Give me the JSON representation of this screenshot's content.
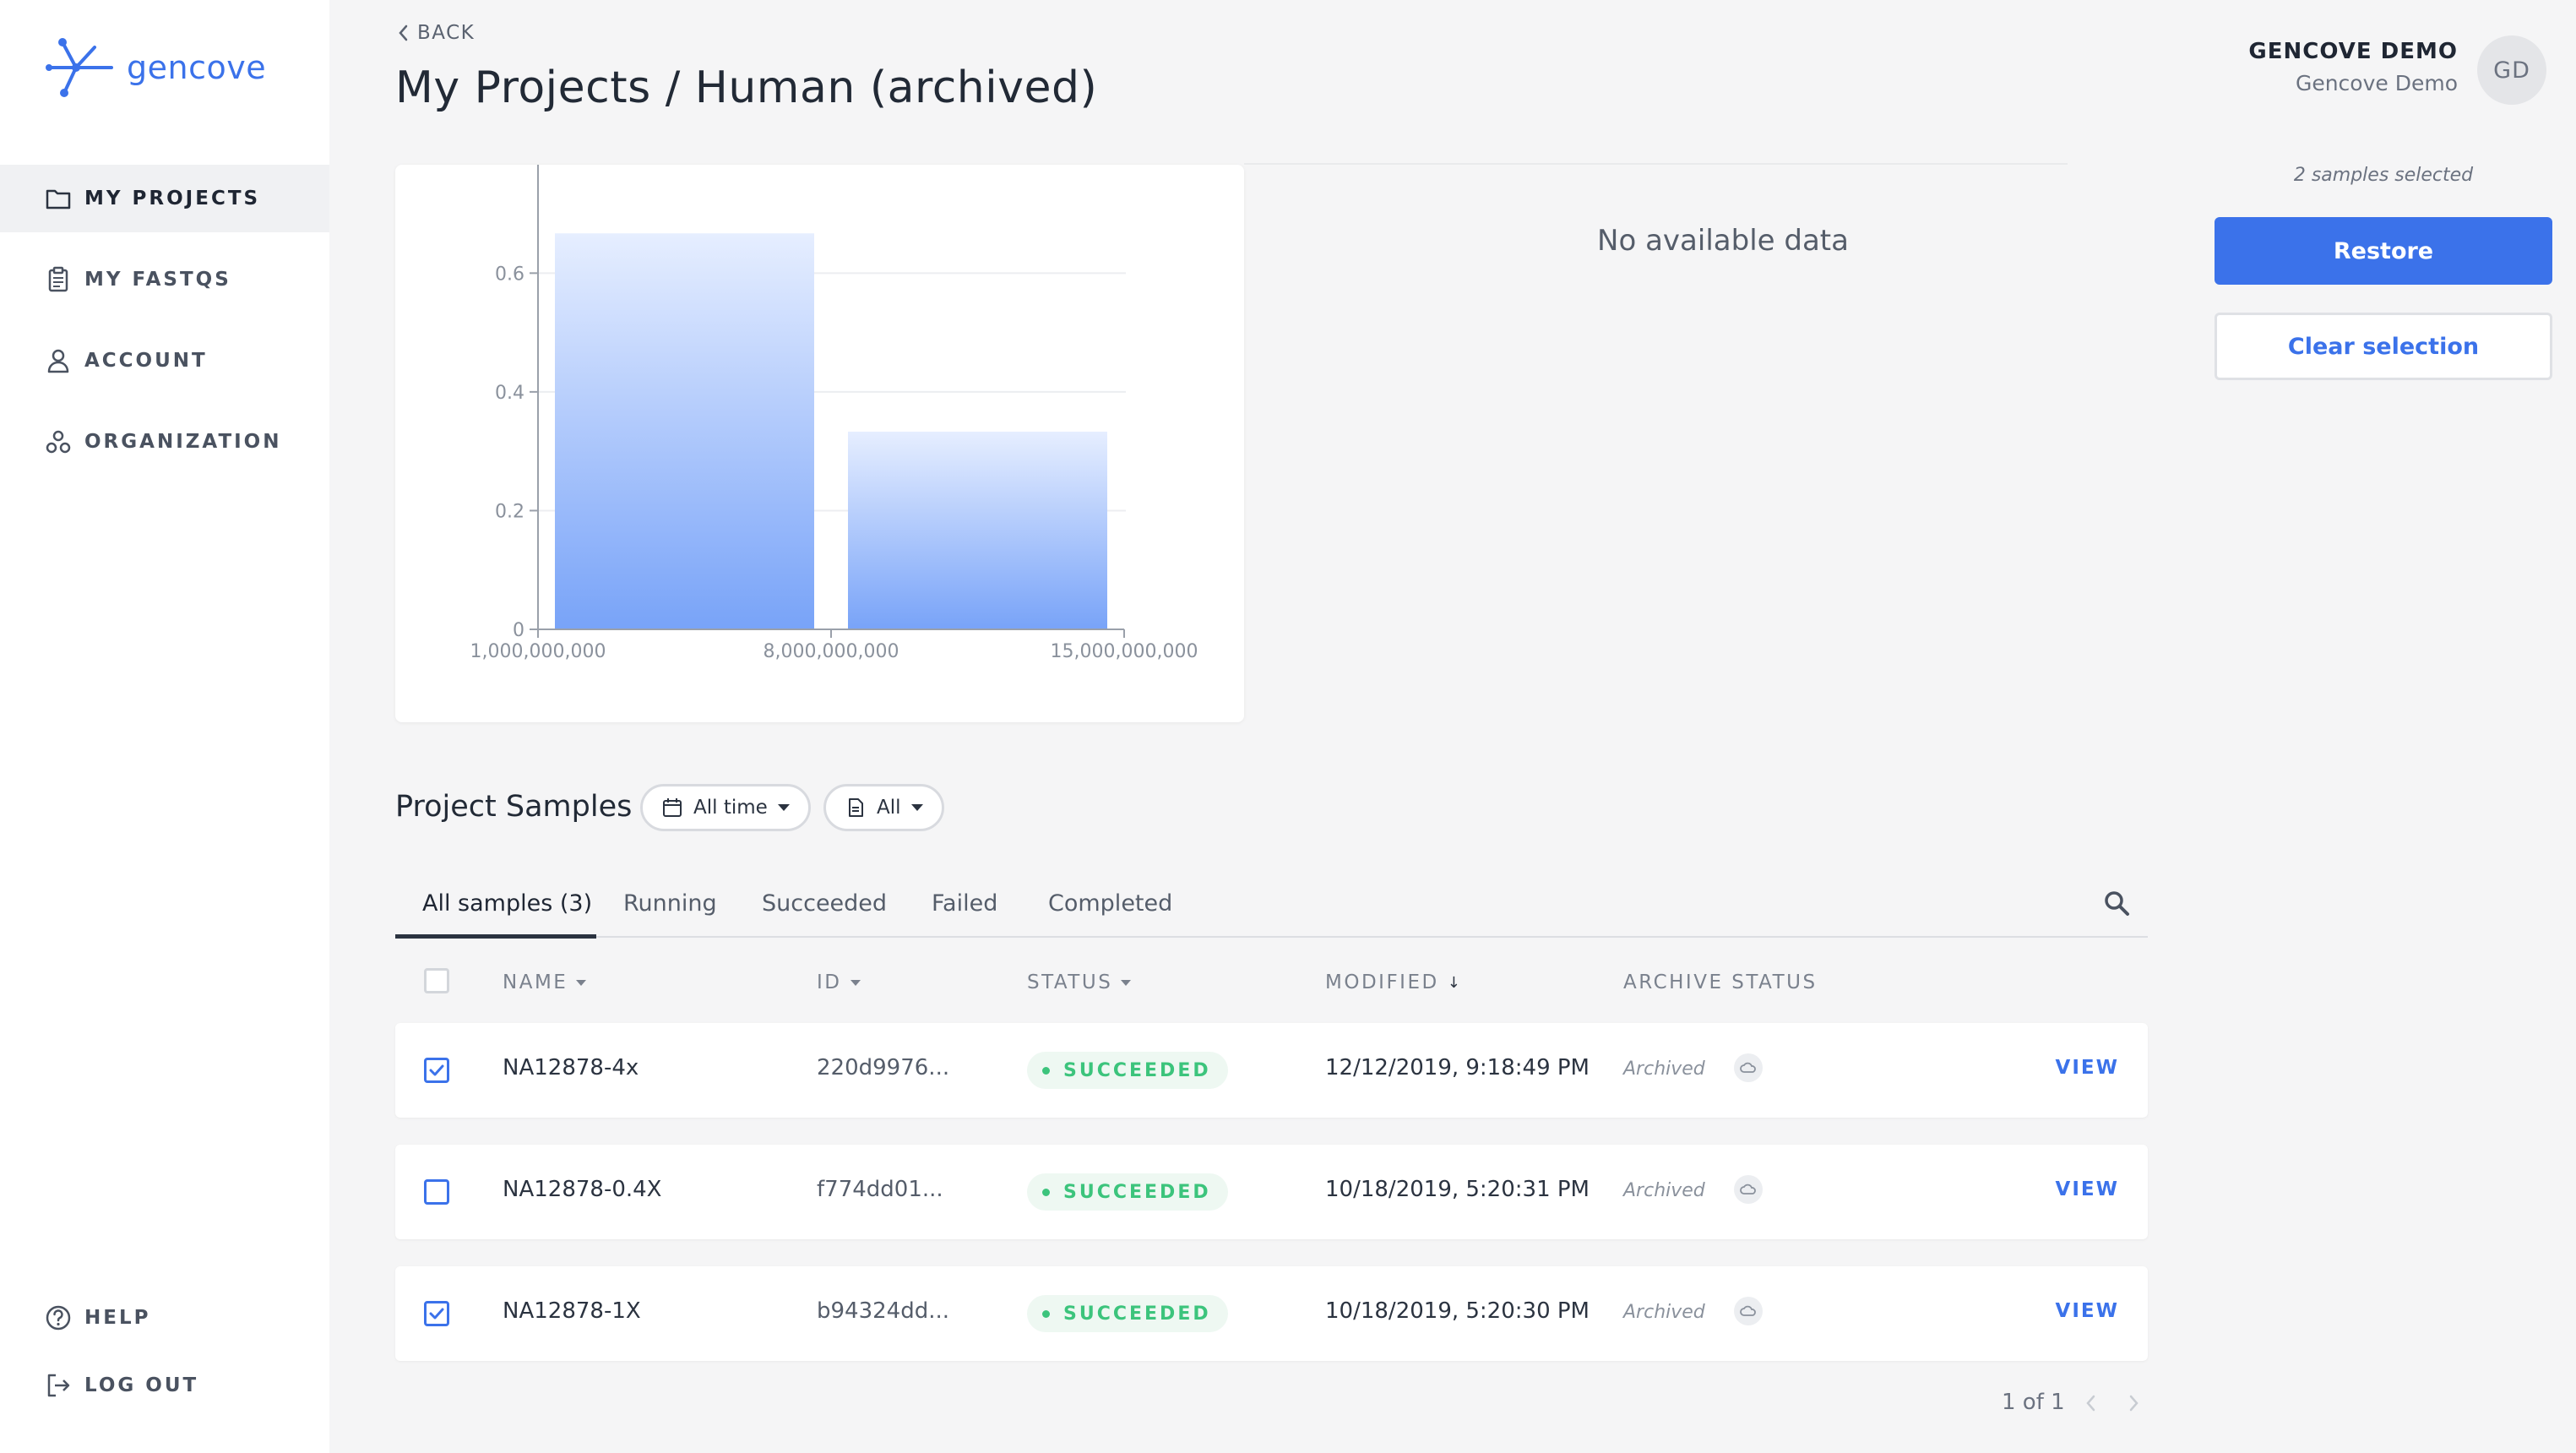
{
  "brand": {
    "name": "gencove"
  },
  "sidebar": {
    "items": [
      {
        "label": "MY PROJECTS",
        "icon": "folder-icon",
        "active": true
      },
      {
        "label": "MY FASTQS",
        "icon": "clipboard-icon",
        "active": false
      },
      {
        "label": "ACCOUNT",
        "icon": "user-icon",
        "active": false
      },
      {
        "label": "ORGANIZATION",
        "icon": "organization-icon",
        "active": false
      }
    ],
    "bottom_items": [
      {
        "label": "HELP",
        "icon": "help-icon"
      },
      {
        "label": "LOG OUT",
        "icon": "logout-icon"
      }
    ]
  },
  "header": {
    "back_label": "BACK",
    "title": "My Projects / Human (archived)",
    "user_name": "GENCOVE DEMO",
    "user_org": "Gencove Demo",
    "avatar_initials": "GD"
  },
  "chart_data": {
    "type": "bar",
    "title": "",
    "xlabel": "",
    "ylabel": "",
    "x_ticks": [
      "1,000,000,000",
      "8,000,000,000",
      "15,000,000,000"
    ],
    "y_ticks": [
      "0",
      "0.2",
      "0.4",
      "0.6"
    ],
    "ylim": [
      0,
      0.72
    ],
    "bins": [
      {
        "from": 1000000000,
        "to": 8000000000,
        "value": 0.667
      },
      {
        "from": 8000000000,
        "to": 15000000000,
        "value": 0.333
      }
    ],
    "grid": true
  },
  "second_chart": {
    "message": "No available data"
  },
  "actions": {
    "selected_count": "2 samples selected",
    "restore_label": "Restore",
    "clear_label": "Clear selection"
  },
  "samples": {
    "title": "Project Samples",
    "filters": [
      {
        "label": "All time",
        "icon": "calendar-icon"
      },
      {
        "label": "All",
        "icon": "document-icon"
      }
    ],
    "tabs": [
      {
        "label": "All samples (3)",
        "active": true
      },
      {
        "label": "Running",
        "active": false
      },
      {
        "label": "Succeeded",
        "active": false
      },
      {
        "label": "Failed",
        "active": false
      },
      {
        "label": "Completed",
        "active": false
      }
    ],
    "columns": [
      "NAME",
      "ID",
      "STATUS",
      "MODIFIED",
      "ARCHIVE STATUS"
    ],
    "rows": [
      {
        "name": "NA12878-4x",
        "id": "220d9976...",
        "status": "SUCCEEDED",
        "modified": "12/12/2019, 9:18:49 PM",
        "archive": "Archived",
        "checked": true,
        "action": "VIEW"
      },
      {
        "name": "NA12878-0.4X",
        "id": "f774dd01...",
        "status": "SUCCEEDED",
        "modified": "10/18/2019, 5:20:31 PM",
        "archive": "Archived",
        "checked": false,
        "action": "VIEW"
      },
      {
        "name": "NA12878-1X",
        "id": "b94324dd...",
        "status": "SUCCEEDED",
        "modified": "10/18/2019, 5:20:30 PM",
        "archive": "Archived",
        "checked": true,
        "action": "VIEW"
      }
    ],
    "pagination": "1 of 1"
  },
  "colors": {
    "accent": "#3b72ea",
    "success": "#3cc47c",
    "bar_top": "#e6eeff",
    "bar_bottom": "#78a3f8"
  }
}
